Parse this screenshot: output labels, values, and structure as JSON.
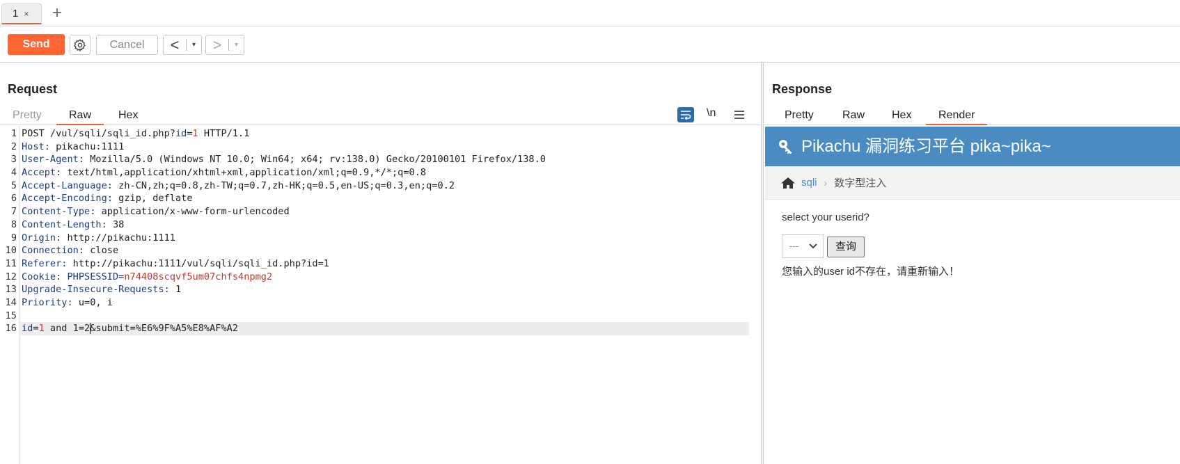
{
  "tabs": [
    {
      "label": "1",
      "close": "×"
    }
  ],
  "tab_add": "+",
  "toolbar": {
    "send_label": "Send",
    "cancel_label": "Cancel",
    "back_arrow": "<",
    "forward_arrow": ">",
    "dropdown_glyph": "▾"
  },
  "request": {
    "title": "Request",
    "tabs": [
      "Pretty",
      "Raw",
      "Hex"
    ],
    "active_tab": "Raw",
    "tools": {
      "newline_label": "\\n"
    },
    "lines": [
      {
        "n": "1",
        "text": "POST /vul/sqli/sqli_id.php?id=1 HTTP/1.1"
      },
      {
        "n": "2",
        "key": "Host:",
        "val": " pikachu:1111"
      },
      {
        "n": "3",
        "key": "User-Agent:",
        "val": " Mozilla/5.0 (Windows NT 10.0; Win64; x64; rv:138.0) Gecko/20100101 Firefox/138.0"
      },
      {
        "n": "4",
        "key": "Accept:",
        "val": " text/html,application/xhtml+xml,application/xml;q=0.9,*/*;q=0.8"
      },
      {
        "n": "5",
        "key": "Accept-Language:",
        "val": " zh-CN,zh;q=0.8,zh-TW;q=0.7,zh-HK;q=0.5,en-US;q=0.3,en;q=0.2"
      },
      {
        "n": "6",
        "key": "Accept-Encoding:",
        "val": " gzip, deflate"
      },
      {
        "n": "7",
        "key": "Content-Type:",
        "val": " application/x-www-form-urlencoded"
      },
      {
        "n": "8",
        "key": "Content-Length:",
        "val": " 38"
      },
      {
        "n": "9",
        "key": "Origin:",
        "val": " http://pikachu:1111"
      },
      {
        "n": "10",
        "key": "Connection:",
        "val": " close"
      },
      {
        "n": "11",
        "key": "Referer:",
        "val": " http://pikachu:1111/vul/sqli/sqli_id.php?id=1"
      },
      {
        "n": "12",
        "key": "Cookie:",
        "val": " "
      },
      {
        "n": "13",
        "key": "Upgrade-Insecure-Requests:",
        "val": " 1"
      },
      {
        "n": "14",
        "key": "Priority:",
        "val": " u=0, i"
      },
      {
        "n": "15",
        "text": ""
      },
      {
        "n": "16",
        "text": ""
      }
    ],
    "line1": {
      "pre": "POST /vul/sqli/sqli_id.php?",
      "param": "id",
      "eq": "=",
      "pval": "1",
      "post": " HTTP/1.1"
    },
    "cookie": {
      "name": "PHPSESSID",
      "eq": "=",
      "value": "n74408scqvf5um07chfs4npmg2"
    },
    "body": {
      "param": "id",
      "eq": "=",
      "pval": "1",
      "rest_a": " and 1=2",
      "rest_b": "&submit=%E6%9F%A5%E8%AF%A2"
    }
  },
  "response": {
    "title": "Response",
    "tabs": [
      "Pretty",
      "Raw",
      "Hex",
      "Render"
    ],
    "active_tab": "Render",
    "render": {
      "header": "Pikachu 漏洞练习平台 pika~pika~",
      "breadcrumb_link": "sqli",
      "breadcrumb_sep": "›",
      "breadcrumb_current": "数字型注入",
      "label": "select your userid?",
      "select_value": "---",
      "button": "查询",
      "message": "您输入的user id不存在，请重新输入！"
    }
  },
  "colors": {
    "accent": "#ff6633",
    "header_blue": "#4a8bc2"
  }
}
